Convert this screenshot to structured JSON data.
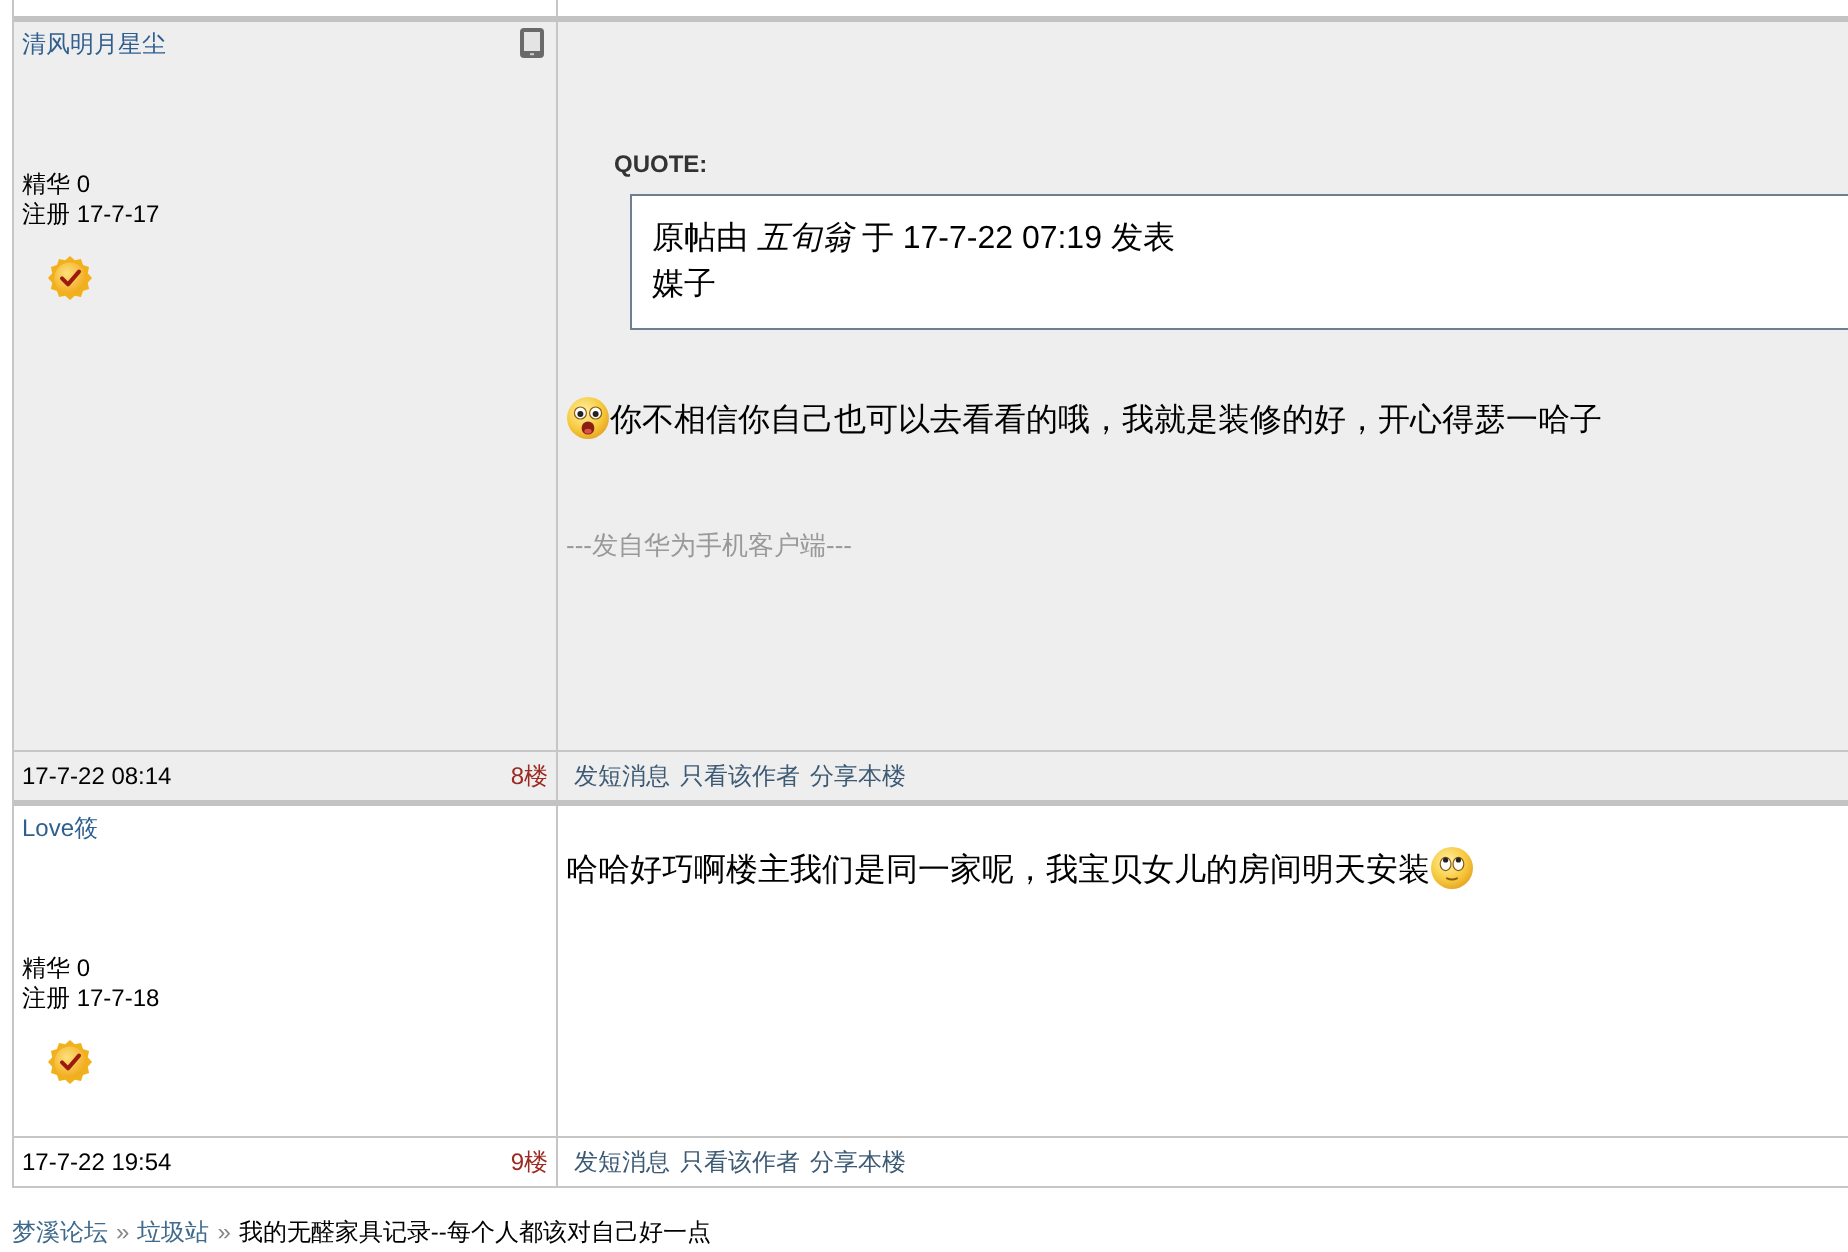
{
  "posts": [
    {
      "author": "清风明月星尘",
      "from_mobile": true,
      "stats": [
        "精华 0",
        "注册 17-7-17"
      ],
      "body": [
        {
          "kind": "quote",
          "label": "QUOTE:",
          "lines": [
            "原帖由 *五旬翁* 于 17-7-22 07:19 发表",
            "媒子"
          ]
        },
        {
          "kind": "text",
          "pieces": [
            {
              "kind": "gasp"
            },
            {
              "kind": "words",
              "text": "你不相信你自己也可以去看看的哦，我就是装修的好，开心得瑟一哈子"
            }
          ]
        },
        {
          "kind": "signature",
          "text": "---发自华为手机客户端---"
        }
      ],
      "time": "17-7-22 08:14",
      "floor": "8楼",
      "actions": [
        "发短消息",
        "只看该作者",
        "分享本楼"
      ]
    },
    {
      "author": "Love筱",
      "from_mobile": false,
      "stats": [
        "精华 0",
        "注册 17-7-18"
      ],
      "body": [
        {
          "kind": "text",
          "pieces": [
            {
              "kind": "words",
              "text": "哈哈好巧啊楼主我们是同一家呢，我宝贝女儿的房间明天安装"
            },
            {
              "kind": "eyeroll"
            }
          ]
        }
      ],
      "time": "17-7-22 19:54",
      "floor": "9楼",
      "actions": [
        "发短消息",
        "只看该作者",
        "分享本楼"
      ]
    }
  ],
  "breadcrumb": [
    {
      "kind": "link",
      "text": "梦溪论坛"
    },
    {
      "kind": "separator",
      "text": "»"
    },
    {
      "kind": "link",
      "text": "垃圾站"
    },
    {
      "kind": "separator",
      "text": "»"
    },
    {
      "kind": "current",
      "text": "我的无醛家具记录--每个人都该对自己好一点"
    }
  ]
}
